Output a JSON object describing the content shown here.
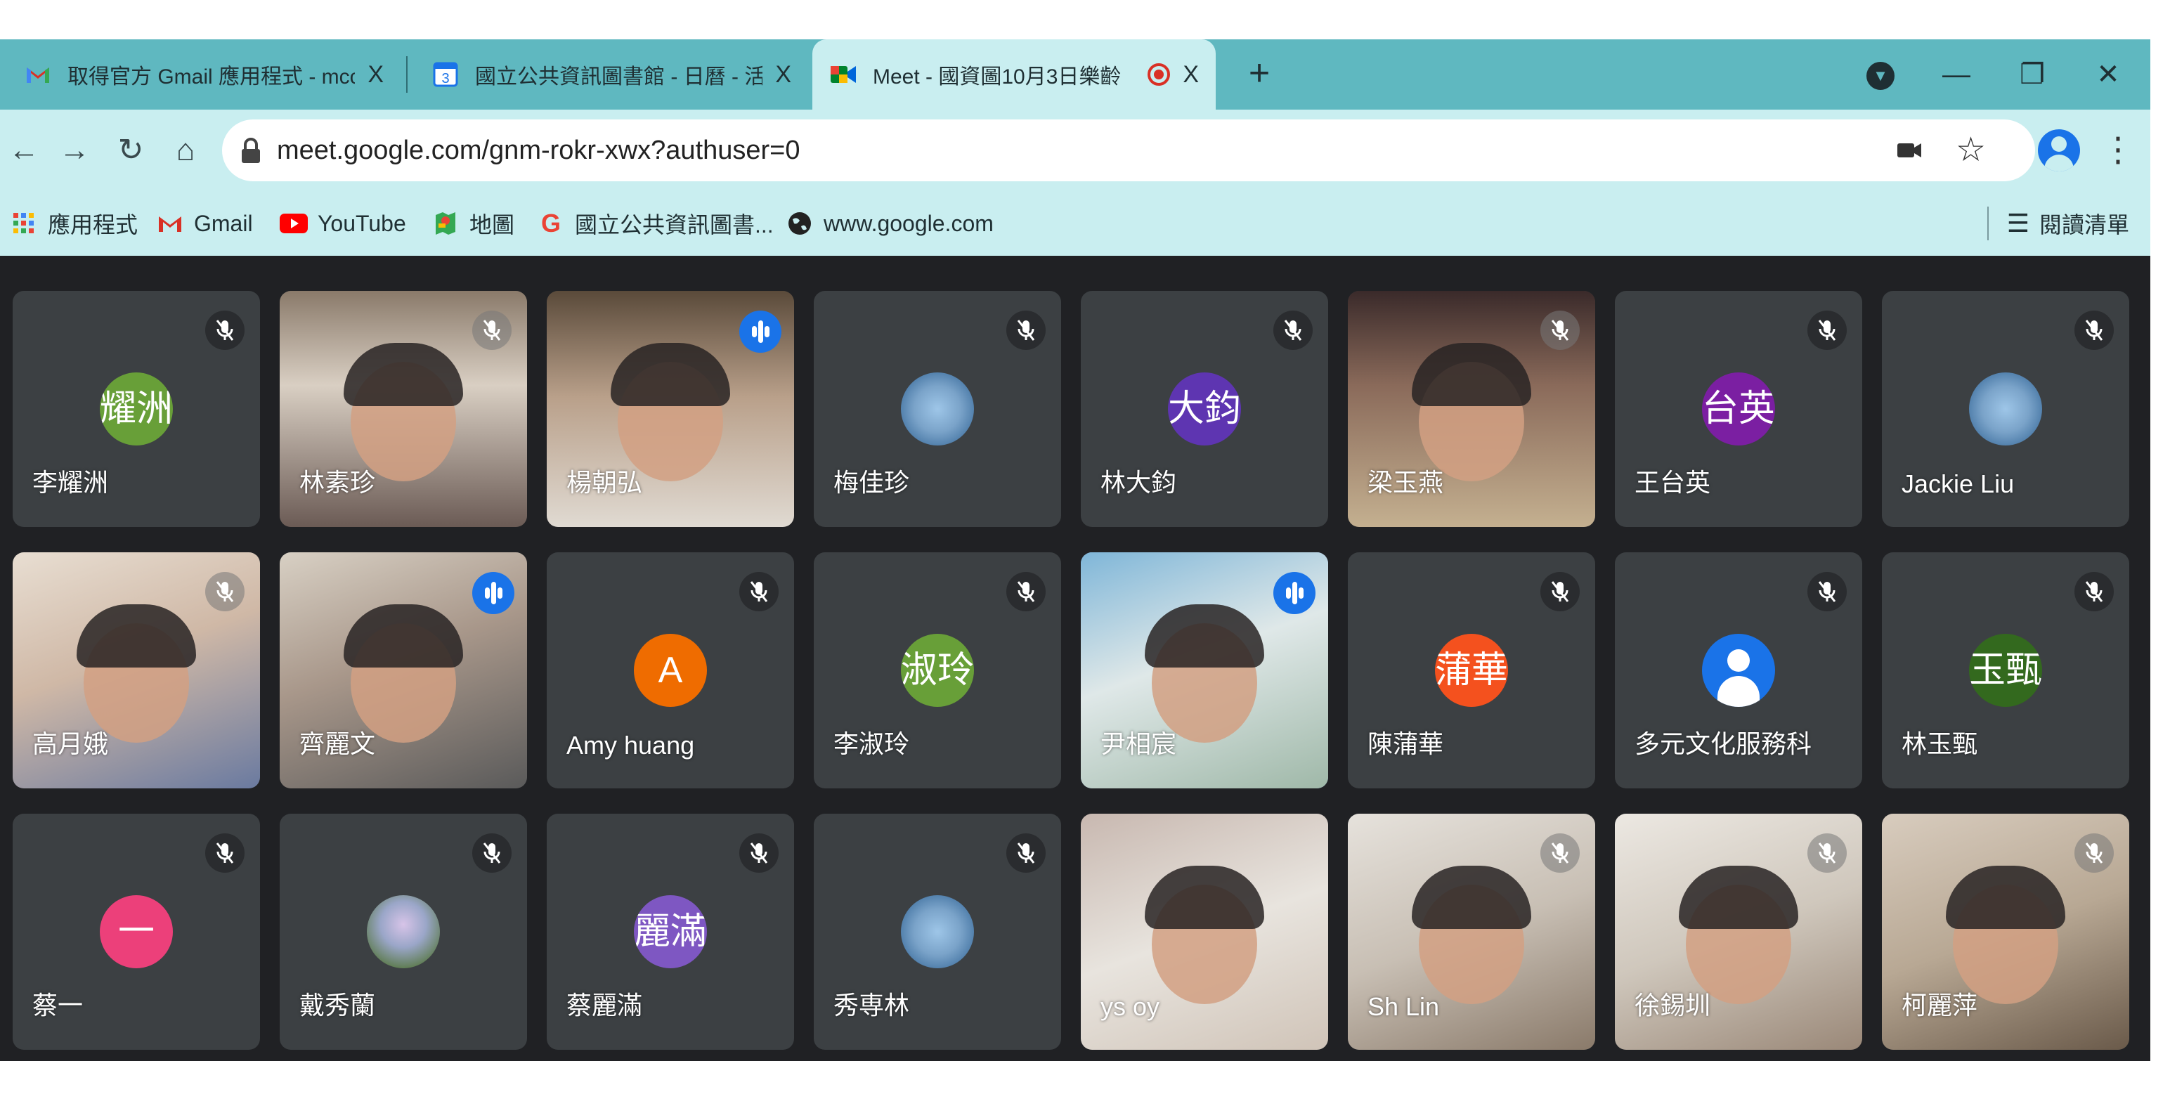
{
  "tabs": [
    {
      "title": "取得官方 Gmail 應用程式 - mcc(",
      "icon": "gmail-icon",
      "close": "X"
    },
    {
      "title": "國立公共資訊圖書館 - 日曆 - 活動",
      "icon": "calendar-icon",
      "close": "X"
    },
    {
      "title": "Meet - 國資圖10月3日樂齡",
      "icon": "meet-icon",
      "close": "X",
      "recording": true
    }
  ],
  "new_tab": "+",
  "window": {
    "minimize": "—",
    "restore": "❐",
    "close": "✕"
  },
  "toolbar": {
    "back": "←",
    "forward": "→",
    "reload": "↻",
    "home": "⌂"
  },
  "address": {
    "url": "meet.google.com/gnm-rokr-xwx?authuser=0"
  },
  "bookmarks": [
    {
      "label": "應用程式",
      "icon": "apps-grid-icon"
    },
    {
      "label": "Gmail",
      "icon": "gmail-icon"
    },
    {
      "label": "YouTube",
      "icon": "youtube-icon"
    },
    {
      "label": "地圖",
      "icon": "maps-icon"
    },
    {
      "label": "國立公共資訊圖書...",
      "icon": "google-icon"
    },
    {
      "label": "www.google.com",
      "icon": "globe-icon"
    }
  ],
  "reading_list": "閱讀清單",
  "participants": [
    {
      "name": "李耀洲",
      "avatar": "耀洲",
      "color": "#689f38",
      "muted": true
    },
    {
      "name": "林素珍",
      "video": true,
      "muted": true
    },
    {
      "name": "楊朝弘",
      "video": true,
      "muted": false
    },
    {
      "name": "梅佳珍",
      "avatar": "",
      "photo": true,
      "muted": true
    },
    {
      "name": "林大鈞",
      "avatar": "大鈞",
      "color": "#5e35b1",
      "muted": true
    },
    {
      "name": "梁玉燕",
      "video": true,
      "muted": true
    },
    {
      "name": "王台英",
      "avatar": "台英",
      "color": "#7b1fa2",
      "muted": true
    },
    {
      "name": "Jackie Liu",
      "avatar": "",
      "photo": true,
      "muted": true
    },
    {
      "name": "高月娥",
      "video": true,
      "muted": true
    },
    {
      "name": "齊麗文",
      "video": true,
      "muted": false
    },
    {
      "name": "Amy huang",
      "avatar": "A",
      "color": "#ef6c00",
      "muted": true
    },
    {
      "name": "李淑玲",
      "avatar": "淑玲",
      "color": "#689f38",
      "muted": true
    },
    {
      "name": "尹相宸",
      "video": true,
      "muted": false,
      "active": true
    },
    {
      "name": "陳蒲華",
      "avatar": "蒲華",
      "color": "#f4511e",
      "muted": true
    },
    {
      "name": "多元文化服務科",
      "avatar": "",
      "person": true,
      "muted": true
    },
    {
      "name": "林玉甄",
      "avatar": "玉甄",
      "color": "#33691e",
      "muted": true
    },
    {
      "name": "蔡一",
      "avatar": "一",
      "color": "#ec407a",
      "muted": true
    },
    {
      "name": "戴秀蘭",
      "avatar": "",
      "photo": true,
      "muted": true
    },
    {
      "name": "蔡麗滿",
      "avatar": "麗滿",
      "color": "#7e57c2",
      "muted": true
    },
    {
      "name": "秀専林",
      "avatar": "",
      "photo": true,
      "muted": true
    },
    {
      "name": "ys oy",
      "video": true,
      "muted": false
    },
    {
      "name": "Sh Lin",
      "video": true,
      "muted": true
    },
    {
      "name": "徐錫圳",
      "video": true,
      "muted": true
    },
    {
      "name": "柯麗萍",
      "video": true,
      "muted": true
    }
  ]
}
